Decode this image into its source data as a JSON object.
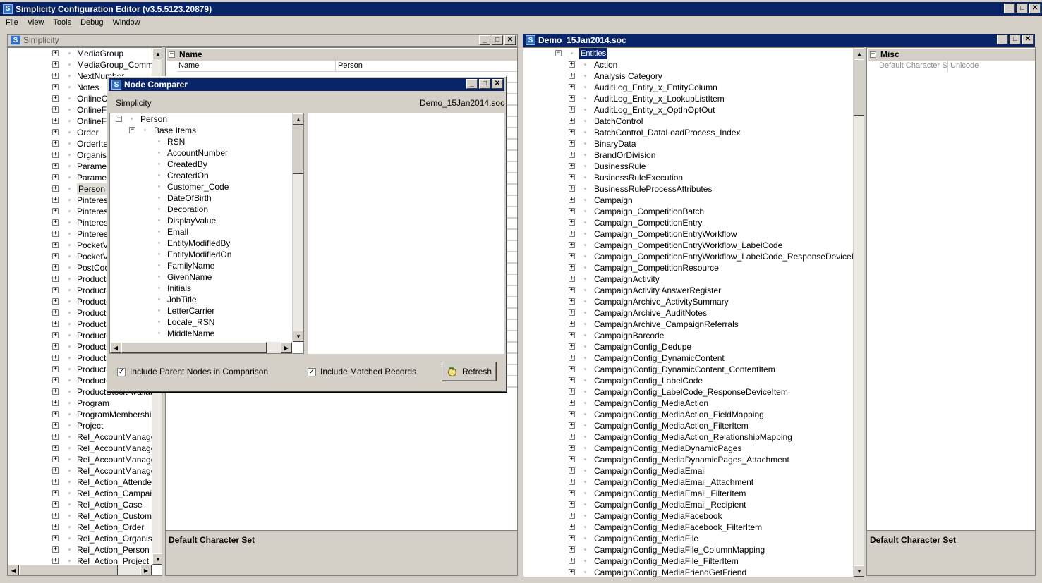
{
  "app": {
    "title": "Simplicity Configuration Editor (v3.5.5123.20879)",
    "logo_letter": "S",
    "menu": [
      "File",
      "View",
      "Tools",
      "Debug",
      "Window"
    ]
  },
  "left_panel": {
    "title": "Simplicity",
    "items": [
      "MediaGroup",
      "MediaGroup_Commur",
      "NextNumber",
      "Notes",
      "OnlineC",
      "OnlineFo",
      "OnlineFo",
      "Order",
      "OrderIte",
      "Organisa",
      "Paramet",
      "Paramet",
      "Person",
      "Pinteres",
      "Pinteres",
      "Pinteres",
      "Pinteres",
      "PocketV",
      "PocketV",
      "PostCoc",
      "Product",
      "Product",
      "Product",
      "Product",
      "Product",
      "Product",
      "Product",
      "ProductS",
      "ProductS",
      "ProductS",
      "ProductStockAvailab",
      "Program",
      "ProgramMembership",
      "Project",
      "Rel_AccountManager",
      "Rel_AccountManager",
      "Rel_AccountManager",
      "Rel_AccountManager",
      "Rel_Action_Attendee",
      "Rel_Action_Campaign",
      "Rel_Action_Case",
      "Rel_Action_Customer",
      "Rel_Action_Order",
      "Rel_Action_Organisat",
      "Rel_Action_Person",
      "Rel_Action_Project"
    ],
    "selected_index": 12,
    "props_header": "Name",
    "prop_row": {
      "name": "Name",
      "value": "Person"
    },
    "desc_title": "Default Character Set"
  },
  "right_panel": {
    "title": "Demo_15Jan2014.soc",
    "root": "Entities",
    "items": [
      "Action",
      "Analysis Category",
      "AuditLog_Entity_x_EntityColumn",
      "AuditLog_Entity_x_LookupListItem",
      "AuditLog_Entity_x_OptInOptOut",
      "BatchControl",
      "BatchControl_DataLoadProcess_Index",
      "BinaryData",
      "BrandOrDivision",
      "BusinessRule",
      "BusinessRuleExecution",
      "BusinessRuleProcessAttributes",
      "Campaign",
      "Campaign_CompetitionBatch",
      "Campaign_CompetitionEntry",
      "Campaign_CompetitionEntryWorkflow",
      "Campaign_CompetitionEntryWorkflow_LabelCode",
      "Campaign_CompetitionEntryWorkflow_LabelCode_ResponseDeviceItem",
      "Campaign_CompetitionResource",
      "CampaignActivity",
      "CampaignActivity AnswerRegister",
      "CampaignArchive_ActivitySummary",
      "CampaignArchive_AuditNotes",
      "CampaignArchive_CampaignReferrals",
      "CampaignBarcode",
      "CampaignConfig_Dedupe",
      "CampaignConfig_DynamicContent",
      "CampaignConfig_DynamicContent_ContentItem",
      "CampaignConfig_LabelCode",
      "CampaignConfig_LabelCode_ResponseDeviceItem",
      "CampaignConfig_MediaAction",
      "CampaignConfig_MediaAction_FieldMapping",
      "CampaignConfig_MediaAction_FilterItem",
      "CampaignConfig_MediaAction_RelationshipMapping",
      "CampaignConfig_MediaDynamicPages",
      "CampaignConfig_MediaDynamicPages_Attachment",
      "CampaignConfig_MediaEmail",
      "CampaignConfig_MediaEmail_Attachment",
      "CampaignConfig_MediaEmail_FilterItem",
      "CampaignConfig_MediaEmail_Recipient",
      "CampaignConfig_MediaFacebook",
      "CampaignConfig_MediaFacebook_FilterItem",
      "CampaignConfig_MediaFile",
      "CampaignConfig_MediaFile_ColumnMapping",
      "CampaignConfig_MediaFile_FilterItem",
      "CampaignConfig_MediaFriendGetFriend"
    ],
    "props_header": "Misc",
    "prop_row": {
      "name": "Default Character S",
      "value": "Unicode"
    },
    "desc_title": "Default Character Set"
  },
  "dialog": {
    "title": "Node Comparer",
    "left_label": "Simplicity",
    "right_label": "Demo_15Jan2014.soc",
    "tree_root": "Person",
    "tree_group": "Base Items",
    "tree_items": [
      "RSN",
      "AccountNumber",
      "CreatedBy",
      "CreatedOn",
      "Customer_Code",
      "DateOfBirth",
      "Decoration",
      "DisplayValue",
      "Email",
      "EntityModifiedBy",
      "EntityModifiedOn",
      "FamilyName",
      "GivenName",
      "Initials",
      "JobTitle",
      "LetterCarrier",
      "Locale_RSN",
      "MiddleName"
    ],
    "include_parent_label": "Include Parent Nodes in Comparison",
    "include_matched_label": "Include Matched Records",
    "include_parent_checked": true,
    "include_matched_checked": true,
    "refresh_label": "Refresh"
  },
  "glyphs": {
    "minimize": "_",
    "maximize": "□",
    "close": "✕",
    "plus": "+",
    "minus": "−",
    "check": "✓",
    "up": "▲",
    "down": "▼",
    "left": "◀",
    "right": "▶"
  },
  "colors": {
    "active_title": "#0a246a",
    "face": "#d4d0c8",
    "selection": "#0a246a"
  }
}
